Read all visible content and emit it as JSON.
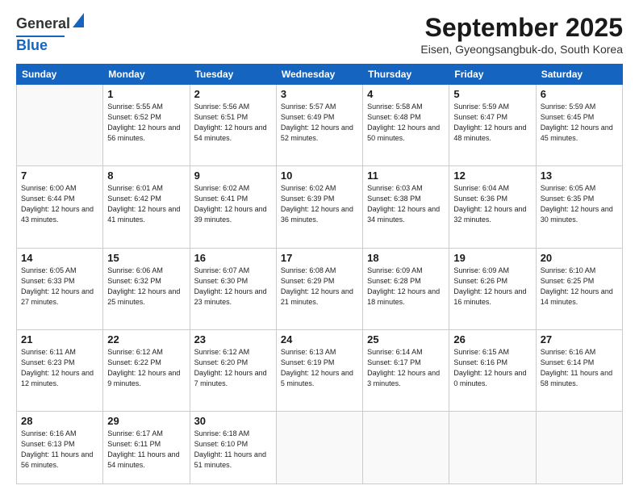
{
  "header": {
    "logo_general": "General",
    "logo_blue": "Blue",
    "month_title": "September 2025",
    "subtitle": "Eisen, Gyeongsangbuk-do, South Korea"
  },
  "days_of_week": [
    "Sunday",
    "Monday",
    "Tuesday",
    "Wednesday",
    "Thursday",
    "Friday",
    "Saturday"
  ],
  "weeks": [
    [
      {
        "day": "",
        "info": ""
      },
      {
        "day": "1",
        "info": "Sunrise: 5:55 AM\nSunset: 6:52 PM\nDaylight: 12 hours\nand 56 minutes."
      },
      {
        "day": "2",
        "info": "Sunrise: 5:56 AM\nSunset: 6:51 PM\nDaylight: 12 hours\nand 54 minutes."
      },
      {
        "day": "3",
        "info": "Sunrise: 5:57 AM\nSunset: 6:49 PM\nDaylight: 12 hours\nand 52 minutes."
      },
      {
        "day": "4",
        "info": "Sunrise: 5:58 AM\nSunset: 6:48 PM\nDaylight: 12 hours\nand 50 minutes."
      },
      {
        "day": "5",
        "info": "Sunrise: 5:59 AM\nSunset: 6:47 PM\nDaylight: 12 hours\nand 48 minutes."
      },
      {
        "day": "6",
        "info": "Sunrise: 5:59 AM\nSunset: 6:45 PM\nDaylight: 12 hours\nand 45 minutes."
      }
    ],
    [
      {
        "day": "7",
        "info": "Sunrise: 6:00 AM\nSunset: 6:44 PM\nDaylight: 12 hours\nand 43 minutes."
      },
      {
        "day": "8",
        "info": "Sunrise: 6:01 AM\nSunset: 6:42 PM\nDaylight: 12 hours\nand 41 minutes."
      },
      {
        "day": "9",
        "info": "Sunrise: 6:02 AM\nSunset: 6:41 PM\nDaylight: 12 hours\nand 39 minutes."
      },
      {
        "day": "10",
        "info": "Sunrise: 6:02 AM\nSunset: 6:39 PM\nDaylight: 12 hours\nand 36 minutes."
      },
      {
        "day": "11",
        "info": "Sunrise: 6:03 AM\nSunset: 6:38 PM\nDaylight: 12 hours\nand 34 minutes."
      },
      {
        "day": "12",
        "info": "Sunrise: 6:04 AM\nSunset: 6:36 PM\nDaylight: 12 hours\nand 32 minutes."
      },
      {
        "day": "13",
        "info": "Sunrise: 6:05 AM\nSunset: 6:35 PM\nDaylight: 12 hours\nand 30 minutes."
      }
    ],
    [
      {
        "day": "14",
        "info": "Sunrise: 6:05 AM\nSunset: 6:33 PM\nDaylight: 12 hours\nand 27 minutes."
      },
      {
        "day": "15",
        "info": "Sunrise: 6:06 AM\nSunset: 6:32 PM\nDaylight: 12 hours\nand 25 minutes."
      },
      {
        "day": "16",
        "info": "Sunrise: 6:07 AM\nSunset: 6:30 PM\nDaylight: 12 hours\nand 23 minutes."
      },
      {
        "day": "17",
        "info": "Sunrise: 6:08 AM\nSunset: 6:29 PM\nDaylight: 12 hours\nand 21 minutes."
      },
      {
        "day": "18",
        "info": "Sunrise: 6:09 AM\nSunset: 6:28 PM\nDaylight: 12 hours\nand 18 minutes."
      },
      {
        "day": "19",
        "info": "Sunrise: 6:09 AM\nSunset: 6:26 PM\nDaylight: 12 hours\nand 16 minutes."
      },
      {
        "day": "20",
        "info": "Sunrise: 6:10 AM\nSunset: 6:25 PM\nDaylight: 12 hours\nand 14 minutes."
      }
    ],
    [
      {
        "day": "21",
        "info": "Sunrise: 6:11 AM\nSunset: 6:23 PM\nDaylight: 12 hours\nand 12 minutes."
      },
      {
        "day": "22",
        "info": "Sunrise: 6:12 AM\nSunset: 6:22 PM\nDaylight: 12 hours\nand 9 minutes."
      },
      {
        "day": "23",
        "info": "Sunrise: 6:12 AM\nSunset: 6:20 PM\nDaylight: 12 hours\nand 7 minutes."
      },
      {
        "day": "24",
        "info": "Sunrise: 6:13 AM\nSunset: 6:19 PM\nDaylight: 12 hours\nand 5 minutes."
      },
      {
        "day": "25",
        "info": "Sunrise: 6:14 AM\nSunset: 6:17 PM\nDaylight: 12 hours\nand 3 minutes."
      },
      {
        "day": "26",
        "info": "Sunrise: 6:15 AM\nSunset: 6:16 PM\nDaylight: 12 hours\nand 0 minutes."
      },
      {
        "day": "27",
        "info": "Sunrise: 6:16 AM\nSunset: 6:14 PM\nDaylight: 11 hours\nand 58 minutes."
      }
    ],
    [
      {
        "day": "28",
        "info": "Sunrise: 6:16 AM\nSunset: 6:13 PM\nDaylight: 11 hours\nand 56 minutes."
      },
      {
        "day": "29",
        "info": "Sunrise: 6:17 AM\nSunset: 6:11 PM\nDaylight: 11 hours\nand 54 minutes."
      },
      {
        "day": "30",
        "info": "Sunrise: 6:18 AM\nSunset: 6:10 PM\nDaylight: 11 hours\nand 51 minutes."
      },
      {
        "day": "",
        "info": ""
      },
      {
        "day": "",
        "info": ""
      },
      {
        "day": "",
        "info": ""
      },
      {
        "day": "",
        "info": ""
      }
    ]
  ]
}
